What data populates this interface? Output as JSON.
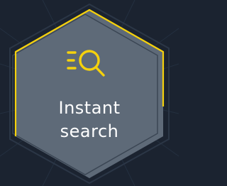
{
  "feature": {
    "label_line1": "Instant",
    "label_line2": "search",
    "icon": "search-filter-icon"
  },
  "colors": {
    "background": "#1b2330",
    "hexagon_fill": "#5e6a78",
    "accent": "#f5d10c",
    "inner_line": "#3b4654",
    "text": "#ffffff"
  }
}
